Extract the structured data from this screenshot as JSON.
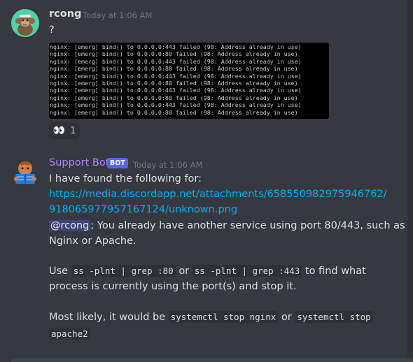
{
  "colors": {
    "background": "#36393f",
    "rcong_name": "#dcddde",
    "bot_name": "#b281ff",
    "link": "#00aff4",
    "bot_tag": "#5865f2"
  },
  "messages": [
    {
      "author": "rcong",
      "timestamp": "Today at 1:06 AM",
      "text": "?",
      "log_lines": [
        "nginx: [emerg] bind() to 0.0.0.0:443 failed (98: Address already in use)",
        "nginx: [emerg] bind() to 0.0.0.0:80 failed (98: Address already in use)",
        "nginx: [emerg] bind() to 0.0.0.0:443 failed (98: Address already in use)",
        "nginx: [emerg] bind() to 0.0.0.0:80 failed (98: Address already in use)",
        "nginx: [emerg] bind() to 0.0.0.0:443 failed (98: Address already in use)",
        "nginx: [emerg] bind() to 0.0.0.0:80 failed (98: Address already in use)",
        "nginx: [emerg] bind() to 0.0.0.0:443 failed (98: Address already in use)",
        "nginx: [emerg] bind() to 0.0.0.0:80 failed (98: Address already in use)",
        "nginx: [emerg] bind() to 0.0.0.0:443 failed (98: Address already in use)",
        "nginx: [emerg] bind() to 0.0.0.0:80 failed (98: Address already in use)"
      ],
      "reaction": {
        "icon": "eyes-emoji",
        "emoji": "👀",
        "count": "1"
      }
    },
    {
      "author": "Support Bot",
      "bot_tag": "BOT",
      "timestamp": "Today at 1:06 AM",
      "line1": "I have found the following for:",
      "link_line1": "https://media.discordapp.net/attachments/658550982975946762/",
      "link_line2": "918065977957167124/unknown.png",
      "mention": "@rcong",
      "line_mention_rest": "; You already have another service using port 80/443, such as",
      "line_nginx": "Nginx or Apache.",
      "use_prefix": "Use",
      "code1": "ss -plnt | grep :80",
      "or1": "or",
      "code2": "ss -plnt | grep :443",
      "use_suffix": "to find what",
      "line_process": "process is currently using the port(s) and stop it.",
      "likely_prefix": "Most likely, it would be",
      "code3": "systemctl stop nginx",
      "or2": "or",
      "code4a": "systemctl stop",
      "code4b": "apache2"
    }
  ]
}
